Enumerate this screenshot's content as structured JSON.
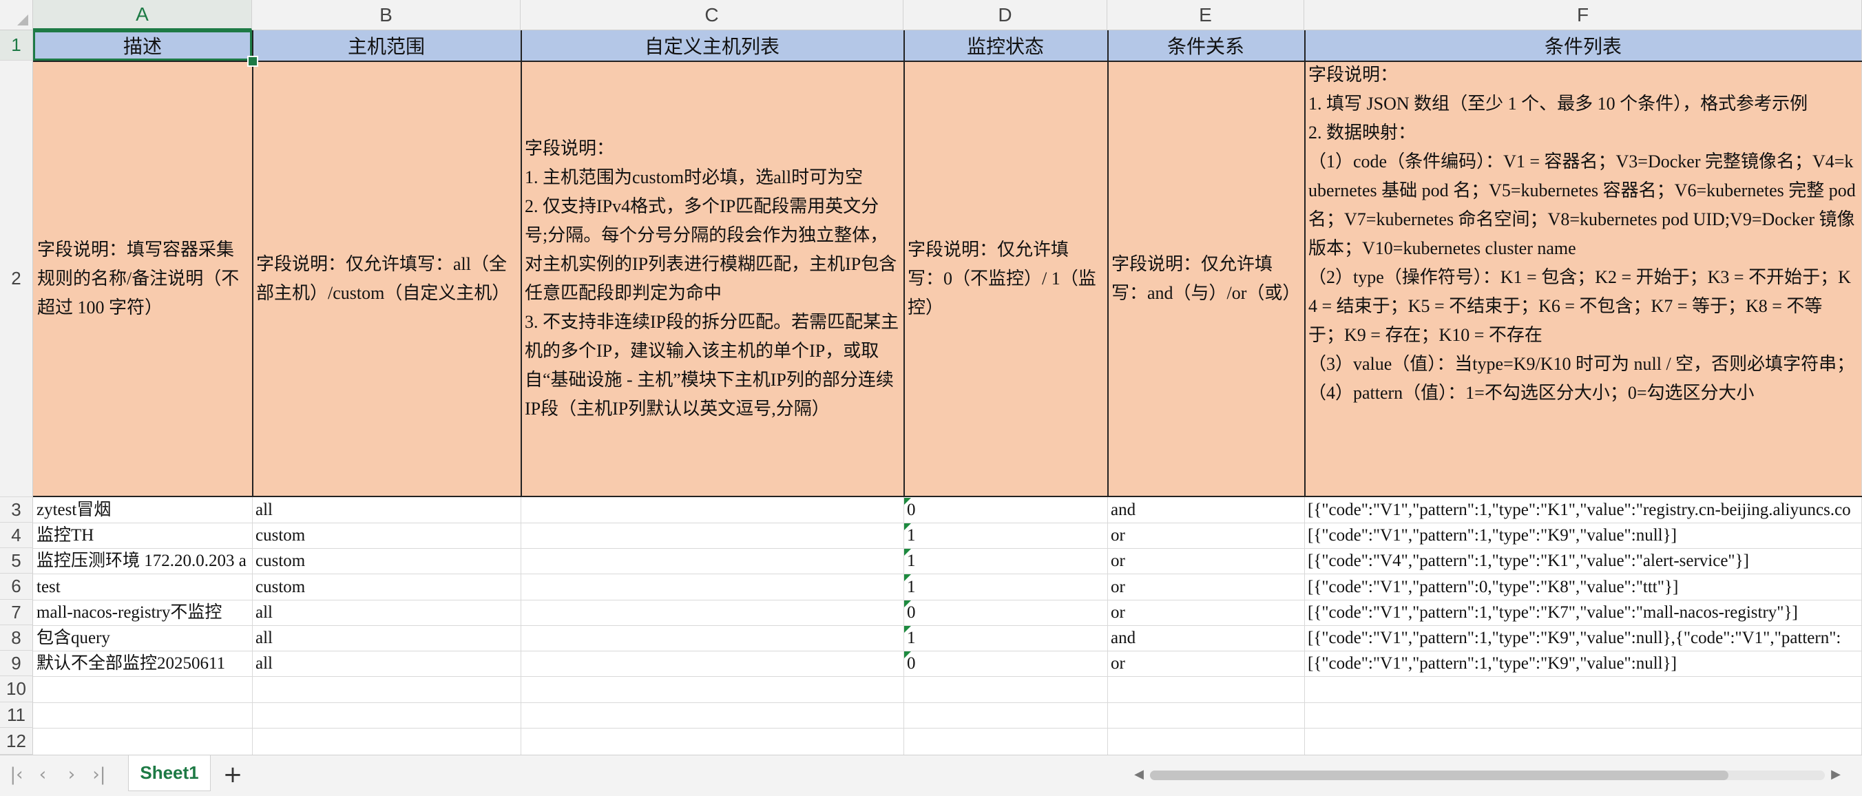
{
  "columns": [
    "A",
    "B",
    "C",
    "D",
    "E",
    "F"
  ],
  "rows": [
    "1",
    "2",
    "3",
    "4",
    "5",
    "6",
    "7",
    "8",
    "9",
    "10",
    "11",
    "12"
  ],
  "headers": [
    "描述",
    "主机范围",
    "自定义主机列表",
    "监控状态",
    "条件关系",
    "条件列表"
  ],
  "descriptions": {
    "a": "字段说明：填写容器采集规则的名称/备注说明（不超过 100 字符）",
    "b": "字段说明：仅允许填写：all（全部主机）/custom（自定义主机）",
    "c": "字段说明：\n1. 主机范围为custom时必填，选all时可为空\n2. 仅支持IPv4格式，多个IP匹配段需用英文分号;分隔。每个分号分隔的段会作为独立整体，对主机实例的IP列表进行模糊匹配，主机IP包含任意匹配段即判定为命中\n3. 不支持非连续IP段的拆分匹配。若需匹配某主机的多个IP，建议输入该主机的单个IP，或取自“基础设施 - 主机”模块下主机IP列的部分连续IP段（主机IP列默认以英文逗号,分隔）",
    "d": "字段说明：仅允许填写：0（不监控）/ 1（监控）",
    "e": "字段说明：仅允许填写：and（与）/or（或）",
    "f": "字段说明：\n1. 填写 JSON 数组（至少 1 个、最多 10 个条件），格式参考示例\n2. 数据映射：\n（1）code（条件编码）：V1 = 容器名；V3=Docker 完整镜像名；V4=kubernetes 基础 pod 名；V5=kubernetes 容器名；V6=kubernetes 完整 pod 名；V7=kubernetes 命名空间；V8=kubernetes pod UID;V9=Docker 镜像版本；V10=kubernetes cluster name\n（2）type（操作符号）：K1 = 包含；K2 = 开始于；K3 = 不开始于；K4 = 结束于；K5 = 不结束于；K6 = 不包含；K7 = 等于；K8 = 不等于；K9 = 存在；K10 = 不存在\n（3）value（值）：当type=K9/K10 时可为 null / 空，否则必填字符串；\n（4）pattern（值）：1=不勾选区分大小；0=勾选区分大小"
  },
  "records": [
    {
      "a": "zytest冒烟",
      "b": "all",
      "c": "",
      "d": "0",
      "e": "and",
      "f": "[{\"code\":\"V1\",\"pattern\":1,\"type\":\"K1\",\"value\":\"registry.cn-beijing.aliyuncs.co"
    },
    {
      "a": "监控TH",
      "b": "custom",
      "c": "",
      "d": "1",
      "e": "or",
      "f": "[{\"code\":\"V1\",\"pattern\":1,\"type\":\"K9\",\"value\":null}]"
    },
    {
      "a": "监控压测环境 172.20.0.203 a",
      "b": "custom",
      "c": "",
      "d": "1",
      "e": "or",
      "f": "[{\"code\":\"V4\",\"pattern\":1,\"type\":\"K1\",\"value\":\"alert-service\"}]"
    },
    {
      "a": "test",
      "b": "custom",
      "c": "",
      "d": "1",
      "e": "or",
      "f": "[{\"code\":\"V1\",\"pattern\":0,\"type\":\"K8\",\"value\":\"ttt\"}]"
    },
    {
      "a": "mall-nacos-registry不监控",
      "b": "all",
      "c": "",
      "d": "0",
      "e": "or",
      "f": "[{\"code\":\"V1\",\"pattern\":1,\"type\":\"K7\",\"value\":\"mall-nacos-registry\"}]"
    },
    {
      "a": "包含query",
      "b": "all",
      "c": "",
      "d": "1",
      "e": "and",
      "f": "[{\"code\":\"V1\",\"pattern\":1,\"type\":\"K9\",\"value\":null},{\"code\":\"V1\",\"pattern\":"
    },
    {
      "a": "默认不全部监控20250611",
      "b": "all",
      "c": "",
      "d": "0",
      "e": "or",
      "f": "[{\"code\":\"V1\",\"pattern\":1,\"type\":\"K9\",\"value\":null}]"
    }
  ],
  "sheet_tab": "Sheet1",
  "add_sheet": "+",
  "colors": {
    "header_fill": "#b4c7e7",
    "desc_fill": "#f8cbad",
    "accent": "#1d7a45"
  }
}
